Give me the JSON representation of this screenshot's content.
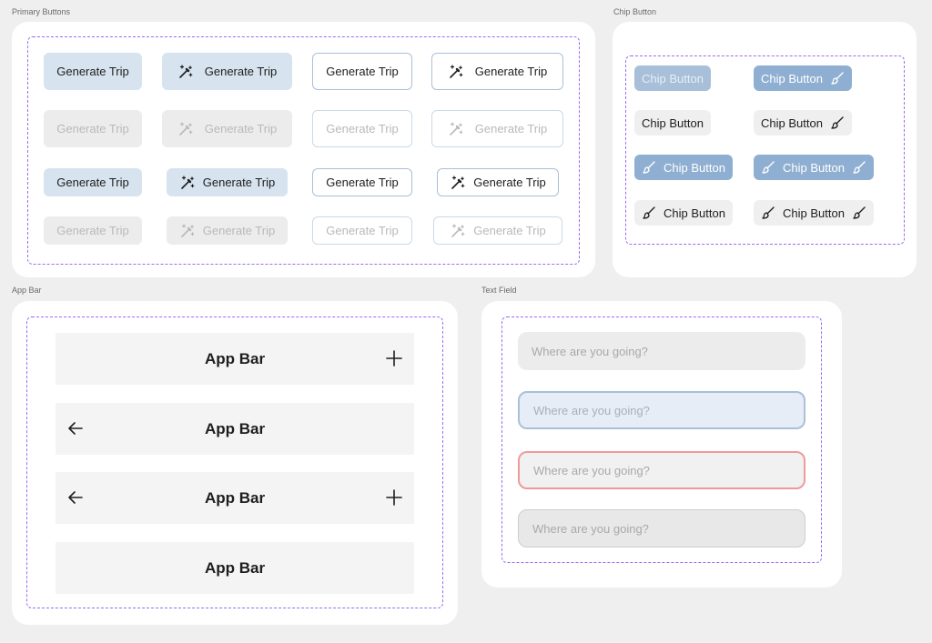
{
  "sections": {
    "primary_buttons": "Primary Buttons",
    "chip_button": "Chip Button",
    "app_bar": "App Bar",
    "text_field": "Text Field"
  },
  "primary_buttons": {
    "label": "Generate Trip",
    "icon": "magic-wand-icon",
    "variants": [
      "filled",
      "filled-with-icon",
      "outline",
      "outline-with-icon"
    ],
    "states": [
      "default",
      "disabled",
      "default-small",
      "disabled-small"
    ]
  },
  "chips": {
    "label": "Chip Button",
    "icon": "paint-brush-icon"
  },
  "app_bar": {
    "title": "App Bar",
    "bars": [
      {
        "back": false,
        "action": true
      },
      {
        "back": true,
        "action": false
      },
      {
        "back": true,
        "action": true
      },
      {
        "back": false,
        "action": false
      }
    ]
  },
  "text_field": {
    "placeholder": "Where are you going?",
    "states": [
      "default",
      "focused",
      "error",
      "disabled"
    ]
  },
  "colors": {
    "dashed_border": "#9b6cf0",
    "primary_fill": "#d7e3ef",
    "chip_blue": "#8fafd2",
    "error_border": "#ef9a9a",
    "focus_border": "#a9c0d8"
  }
}
